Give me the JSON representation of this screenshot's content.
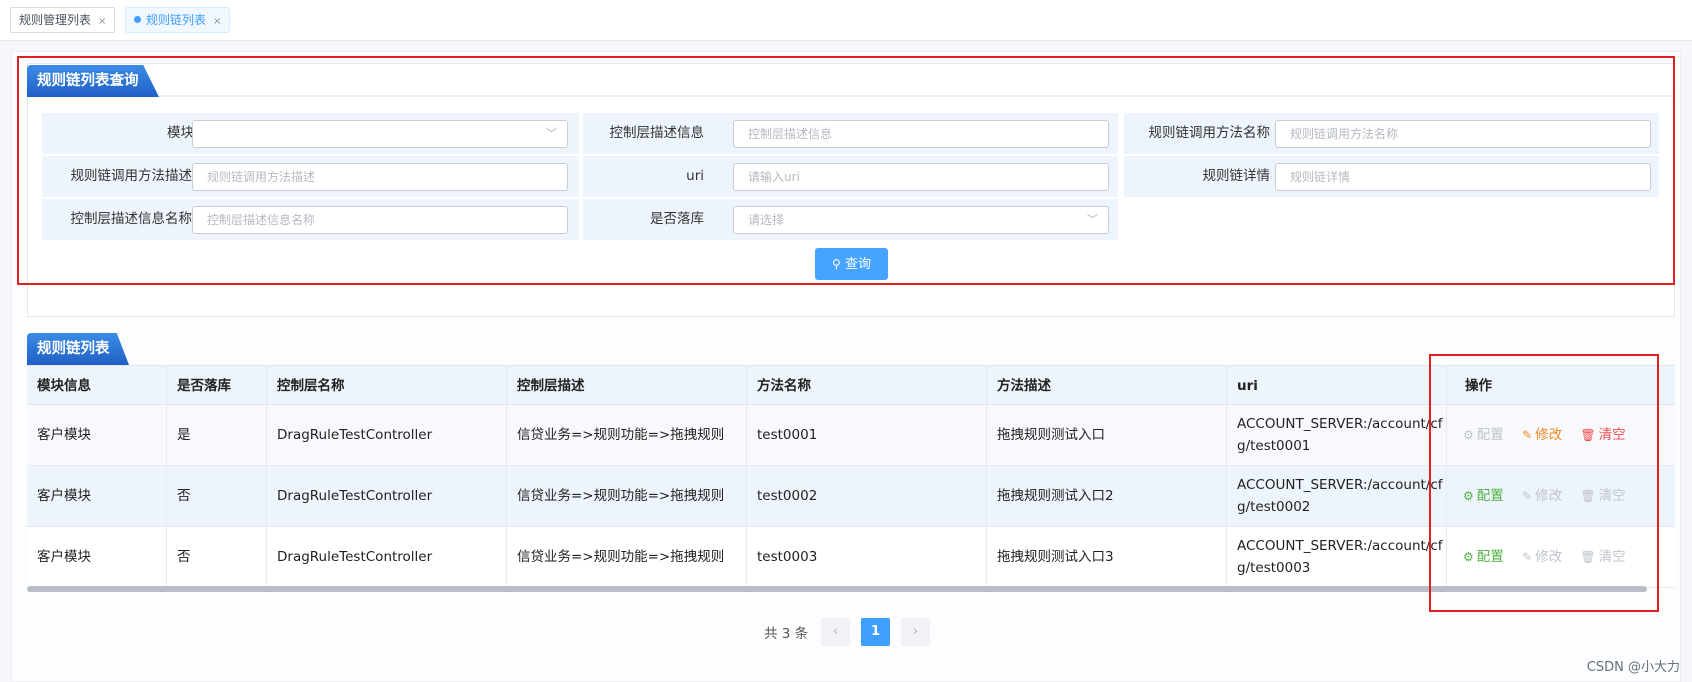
{
  "tabs": [
    {
      "label": "规则管理列表",
      "close": "×"
    },
    {
      "label": "规则链列表",
      "close": "×"
    }
  ],
  "query": {
    "title": "规则链列表查询",
    "fields": {
      "module": {
        "label": "模块",
        "value": ""
      },
      "ctrl_desc": {
        "label": "控制层描述信息",
        "placeholder": "控制层描述信息"
      },
      "method_name": {
        "label": "规则链调用方法名称",
        "placeholder": "规则链调用方法名称"
      },
      "method_desc": {
        "label": "规则链调用方法描述",
        "placeholder": "规则链调用方法描述"
      },
      "uri": {
        "label": "uri",
        "placeholder": "请输入uri"
      },
      "detail": {
        "label": "规则链详情",
        "placeholder": "规则链详情"
      },
      "ctrl_name": {
        "label": "控制层描述信息名称",
        "placeholder": "控制层描述信息名称"
      },
      "persist": {
        "label": "是否落库",
        "placeholder": "请选择"
      }
    },
    "button": "查询"
  },
  "table": {
    "title": "规则链列表",
    "headers": [
      "模块信息",
      "是否落库",
      "控制层名称",
      "控制层描述",
      "方法名称",
      "方法描述",
      "uri",
      "操作"
    ],
    "rows": [
      {
        "module": "客户模块",
        "persist": "是",
        "ctrl": "DragRuleTestController",
        "ctrl_desc": "信贷业务=>规则功能=>拖拽规则",
        "method": "test0001",
        "method_desc": "拖拽规则测试入口",
        "uri": "ACCOUNT_SERVER:/account/cfg/test0001"
      },
      {
        "module": "客户模块",
        "persist": "否",
        "ctrl": "DragRuleTestController",
        "ctrl_desc": "信贷业务=>规则功能=>拖拽规则",
        "method": "test0002",
        "method_desc": "拖拽规则测试入口2",
        "uri": "ACCOUNT_SERVER:/account/cfg/test0002"
      },
      {
        "module": "客户模块",
        "persist": "否",
        "ctrl": "DragRuleTestController",
        "ctrl_desc": "信贷业务=>规则功能=>拖拽规则",
        "method": "test0003",
        "method_desc": "拖拽规则测试入口3",
        "uri": "ACCOUNT_SERVER:/account/cfg/test0003"
      }
    ],
    "ops": {
      "config": "配置",
      "edit": "修改",
      "clear": "清空"
    }
  },
  "pagination": {
    "total": "共 3 条",
    "current": "1",
    "prev": "‹",
    "next": "›"
  },
  "watermark": "CSDN @小大力"
}
